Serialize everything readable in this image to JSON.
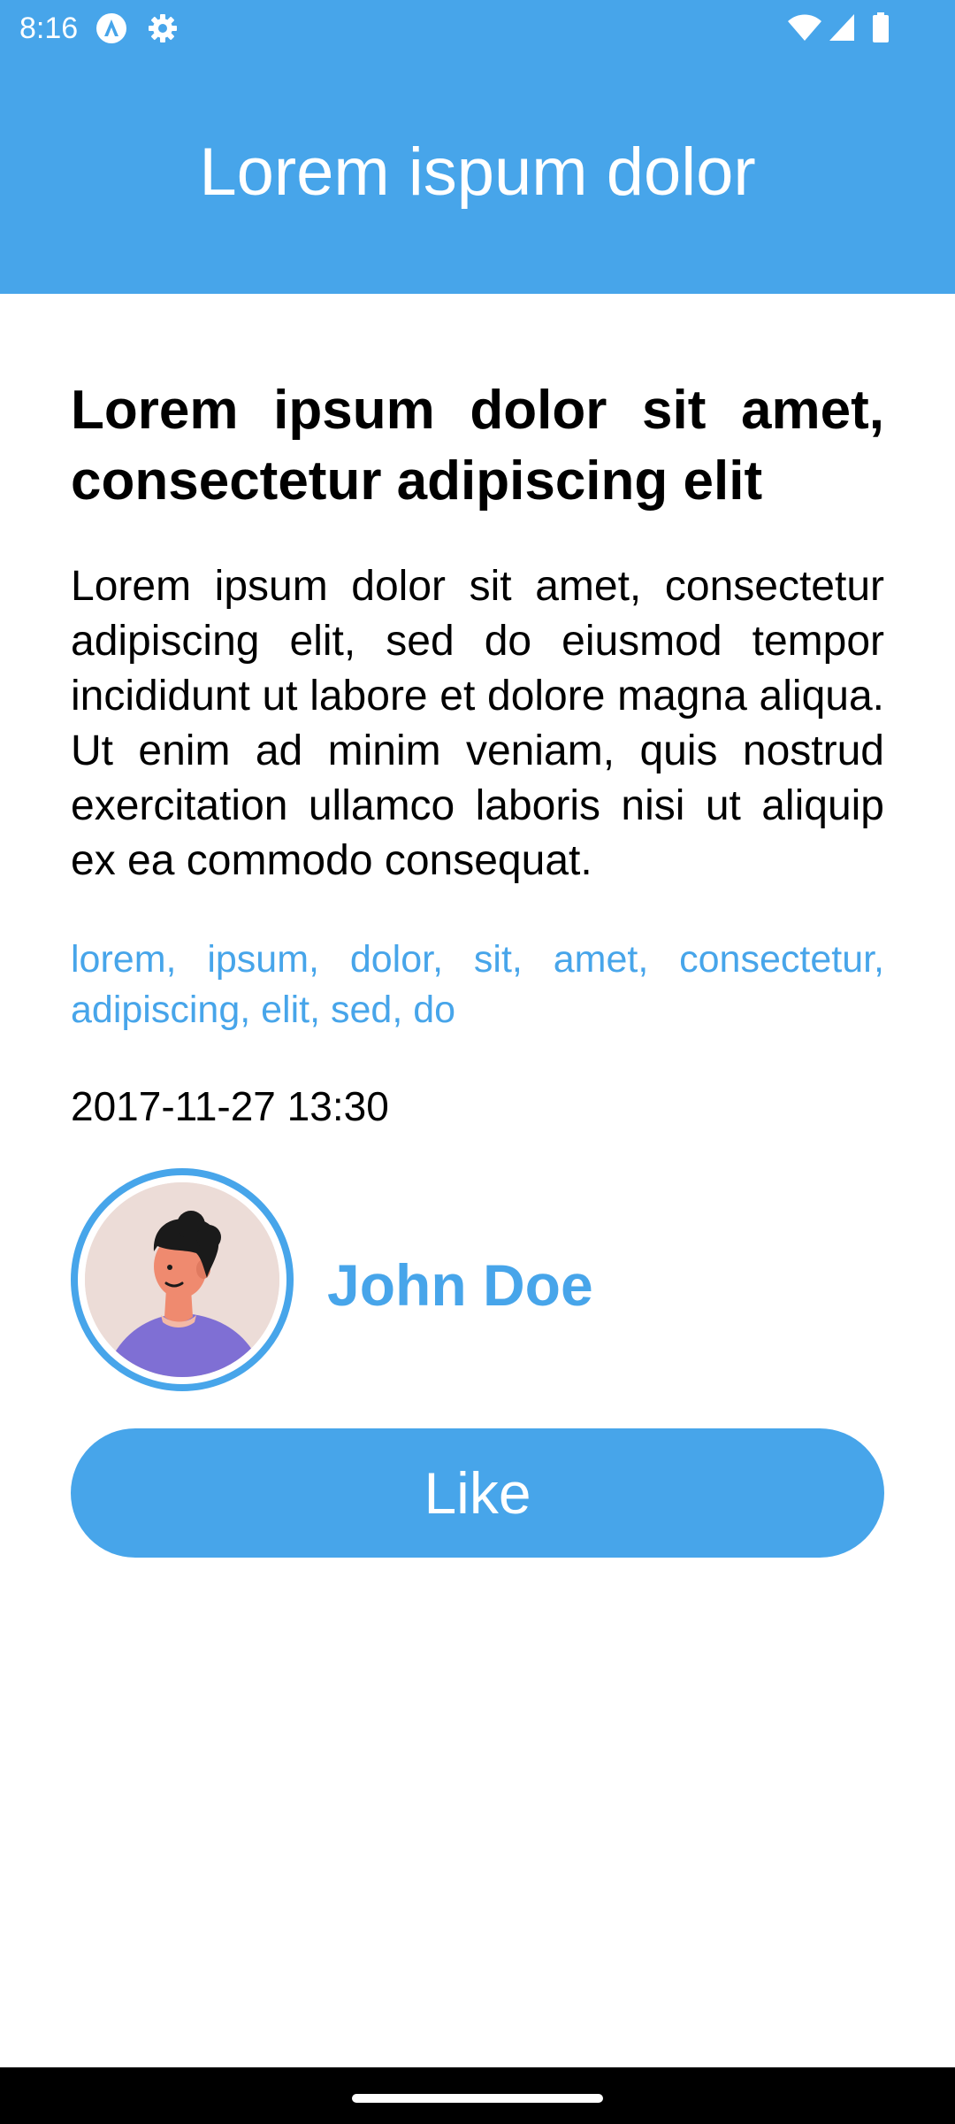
{
  "status_bar": {
    "time": "8:16",
    "icons": [
      "app-notification-icon",
      "settings-gear-icon",
      "wifi-icon",
      "signal-icon",
      "battery-icon"
    ]
  },
  "app_bar": {
    "title": "Lorem ispum dolor"
  },
  "article": {
    "headline": "Lorem ipsum dolor sit amet, consectetur adipiscing elit",
    "body": "Lorem ipsum dolor sit amet, consectetur adipiscing elit, sed do eiusmod tempor incididunt ut labore et dolore magna aliqua. Ut enim ad minim veniam, quis nostrud exercitation ullamco laboris nisi ut aliquip ex ea commodo consequat.",
    "tags": "lorem, ipsum, dolor, sit, amet, consectetur, adipiscing, elit, sed, do",
    "timestamp": "2017-11-27 13:30"
  },
  "author": {
    "name": "John Doe",
    "avatar_icon": "person-avatar-icon"
  },
  "actions": {
    "like_label": "Like"
  },
  "colors": {
    "accent": "#47a5ea",
    "text": "#000000",
    "background": "#ffffff",
    "avatar_bg": "#ecdcd7",
    "shirt": "#7f6fd4",
    "skin": "#ef8a6f"
  }
}
